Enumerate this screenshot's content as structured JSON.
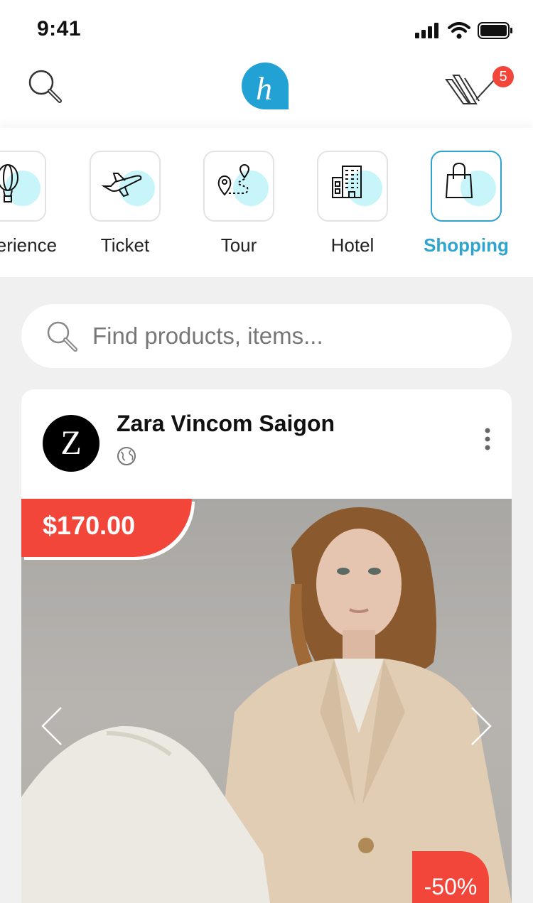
{
  "status_bar": {
    "time": "9:41"
  },
  "header": {
    "logo_letter": "h",
    "cart_badge_count": "5"
  },
  "categories": [
    {
      "label": "Experience",
      "icon": "balloon-icon",
      "active": false
    },
    {
      "label": "Ticket",
      "icon": "plane-icon",
      "active": false
    },
    {
      "label": "Tour",
      "icon": "map-route-icon",
      "active": false
    },
    {
      "label": "Hotel",
      "icon": "building-icon",
      "active": false
    },
    {
      "label": "Shopping",
      "icon": "shopping-bag-icon",
      "active": true
    }
  ],
  "search": {
    "placeholder": "Find products, items..."
  },
  "post": {
    "store_logo_letter": "Z",
    "store_name": "Zara Vincom Saigon",
    "price": "$170.00",
    "discount": "-50%"
  },
  "colors": {
    "accent": "#2ea4cf",
    "sale": "#f3463a",
    "icon_blob": "#c8f5fa"
  }
}
